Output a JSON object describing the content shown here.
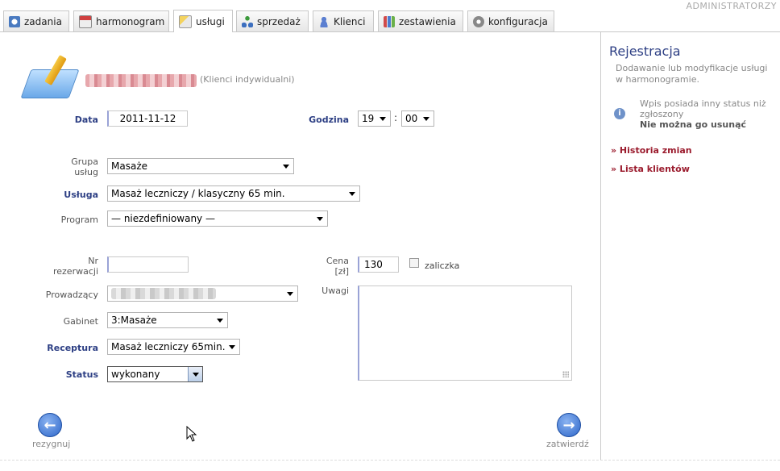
{
  "header": {
    "user_label": "ADMINISTRATORZY",
    "tabs": [
      {
        "label": "zadania",
        "icon": "clock-icon",
        "active": false
      },
      {
        "label": "harmonogram",
        "icon": "calendar-icon",
        "active": false
      },
      {
        "label": "usługi",
        "icon": "pencil-note-icon",
        "active": true
      },
      {
        "label": "sprzedaż",
        "icon": "network-icon",
        "active": false
      },
      {
        "label": "Klienci",
        "icon": "person-icon",
        "active": false
      },
      {
        "label": "zestawienia",
        "icon": "bar-chart-icon",
        "active": false
      },
      {
        "label": "konfiguracja",
        "icon": "gear-icon",
        "active": false
      }
    ]
  },
  "form": {
    "client_type": "(Klienci indywidualni)",
    "date_label": "Data",
    "date_value": "2011-11-12",
    "time_label": "Godzina",
    "hour_value": "19",
    "time_separator": ":",
    "minute_value": "00",
    "group_label": "Grupa usług",
    "group_value": "Masaże",
    "service_label": "Usługa",
    "service_value": "Masaż leczniczy / klasyczny 65 min.",
    "program_label": "Program",
    "program_value": "— niezdefiniowany —",
    "reservation_label": "Nr rezerwacji",
    "reservation_value": "",
    "price_label": "Cena [zł]",
    "price_value": "130",
    "advance_label": "zaliczka",
    "host_label": "Prowadzący",
    "notes_label": "Uwagi",
    "room_label": "Gabinet",
    "room_value": "3:Masaże",
    "recipe_label": "Receptura",
    "recipe_value": "Masaż leczniczy 65min.",
    "status_label": "Status",
    "status_value": "wykonany"
  },
  "actions": {
    "cancel_label": "rezygnuj",
    "confirm_label": "zatwierdź"
  },
  "sidebar": {
    "title": "Rejestracja",
    "description": "Dodawanie lub modyfikacje usługi w harmonogramie.",
    "info_line1": "Wpis posiada inny status niż zgłoszony",
    "info_line2": "Nie można go usunąć",
    "links": [
      "» Historia zmian",
      "» Lista klientów"
    ]
  },
  "colors": {
    "accent": "#2d3f84",
    "link": "#9b1c2e",
    "button": "#2d66c9"
  }
}
